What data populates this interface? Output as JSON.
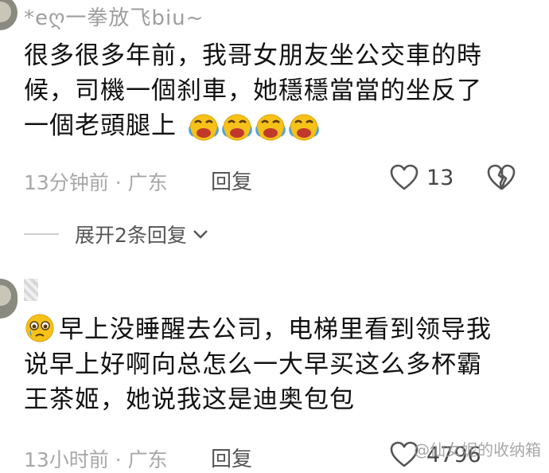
{
  "comments": [
    {
      "username": "*eღ一拳放飞biu~",
      "text_line1": "很多很多年前，我哥女朋友坐公交車的時",
      "text_line2": "候，司機一個刹車，她穩穩當當的坐反了",
      "text_line3": "一個老頭腿上",
      "emoji_names": [
        "laugh-cry-icon",
        "laugh-cry-icon",
        "laugh-cry-icon",
        "laugh-cry-icon"
      ],
      "meta": "13分钟前 · 广东",
      "reply_label": "回复",
      "likes": "13",
      "expand_label": "展开2条回复"
    },
    {
      "username": "",
      "lead_emoji": "teary-face-icon",
      "text_line1": "早上没睡醒去公司，电梯里看到领导我",
      "text_line2": "说早上好啊向总怎么一大早买这么多杯霸",
      "text_line3": "王茶姬，她说我这是迪奥包包",
      "meta": "13小时前 · 广东",
      "reply_label": "回复",
      "likes": "4796"
    }
  ],
  "watermark": "@仙女妮的收纳箱",
  "colors": {
    "meta": "#a8a8a8",
    "text": "#111111",
    "emoji": "#f6c21a"
  }
}
